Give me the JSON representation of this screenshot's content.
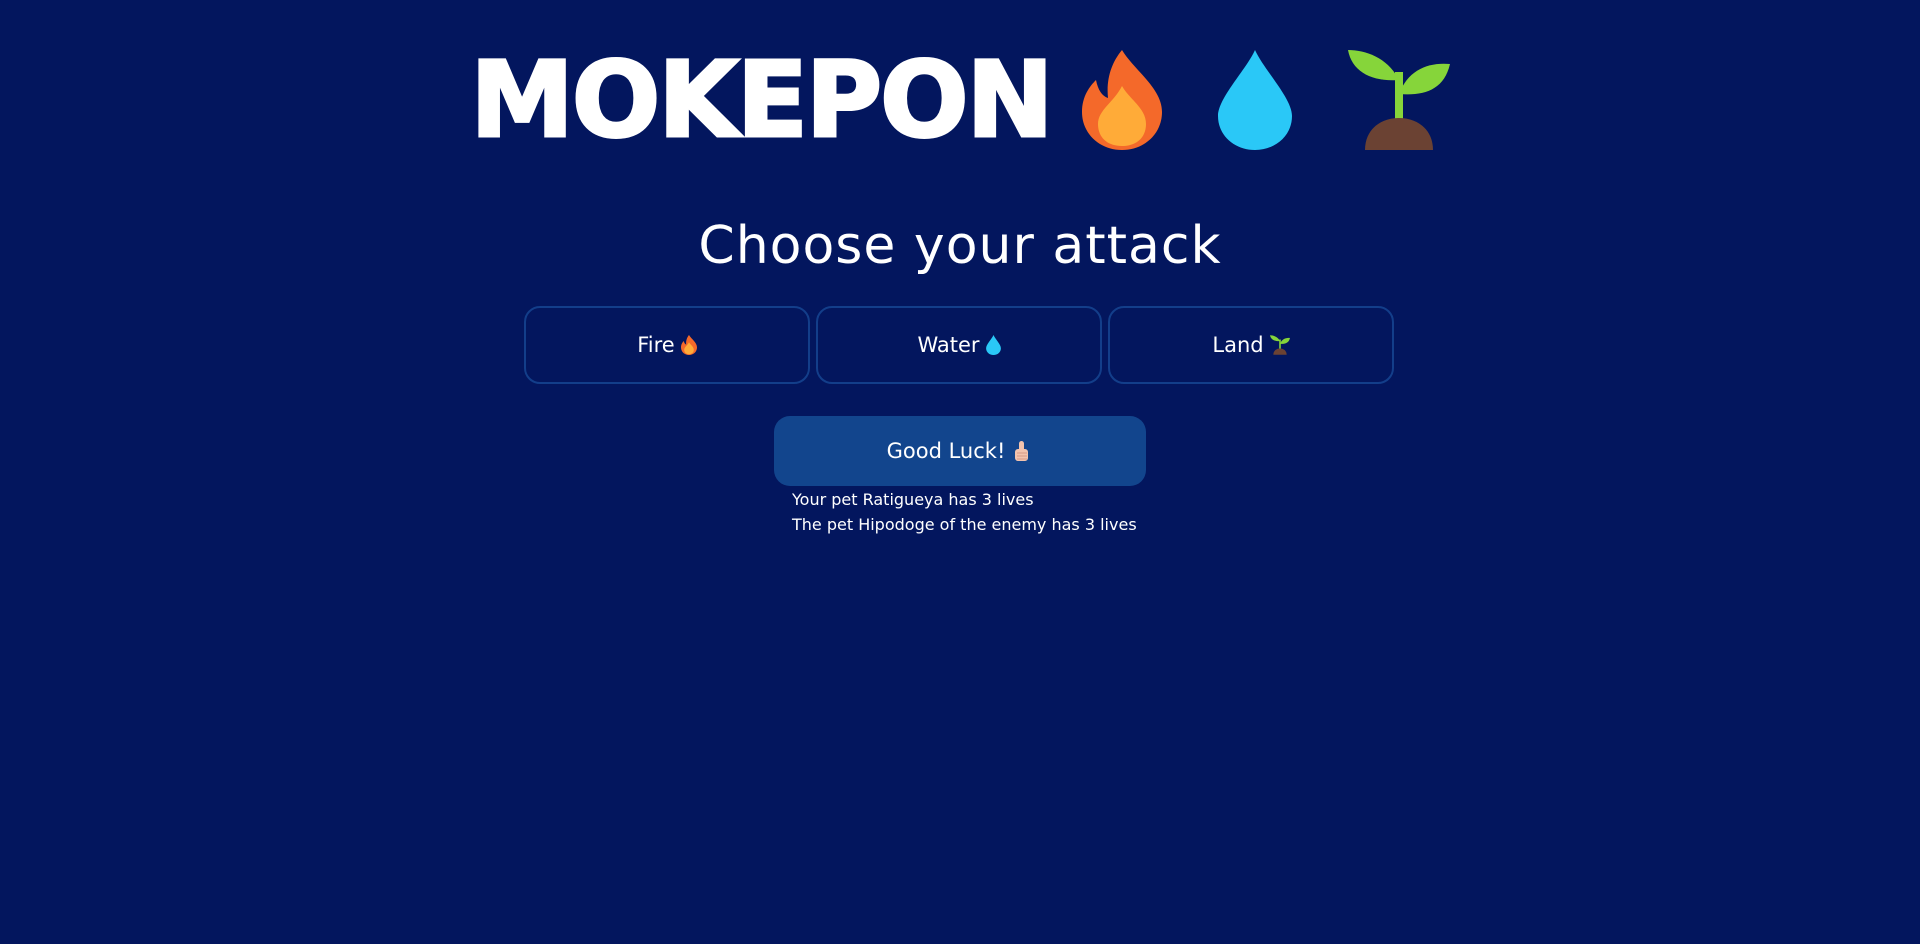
{
  "header": {
    "logo_text": "MOKEPON",
    "icons": [
      "fire-icon",
      "water-drop-icon",
      "seedling-icon"
    ]
  },
  "main": {
    "title": "Choose your attack",
    "attacks": [
      {
        "label": "Fire",
        "icon": "fire-icon"
      },
      {
        "label": "Water",
        "icon": "water-drop-icon"
      },
      {
        "label": "Land",
        "icon": "seedling-icon"
      }
    ],
    "good_luck_label": "Good Luck!",
    "good_luck_icon": "thumbs-up-icon"
  },
  "messages": {
    "player_status": "Your pet Ratigueya has 3 lives",
    "enemy_status": "The pet Hipodoge of the enemy has 3 lives"
  },
  "colors": {
    "background": "#03165e",
    "button_border": "#133e8a",
    "good_luck_bg": "#12458d",
    "fire_outer": "#f4692a",
    "fire_inner": "#ffab38",
    "water": "#2ac8f7",
    "leaf": "#86d53a",
    "soil": "#6b4233"
  }
}
